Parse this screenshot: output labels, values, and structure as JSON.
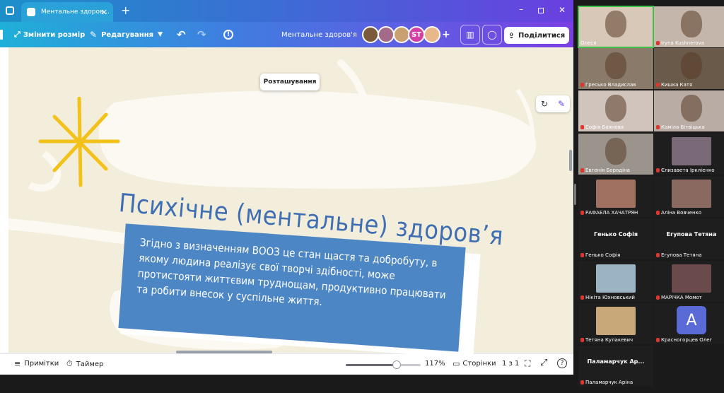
{
  "canva": {
    "tab_title": "Ментальне здоров...",
    "toolbar": {
      "resize": "Змінити розмір",
      "edit": "Редагування",
      "doc_title": "Ментальне здоров'я",
      "collab_initials": "ST",
      "share": "Поділитися"
    },
    "tooltip": "Розташування",
    "slide": {
      "title": "Психічне (ментальне) здоров’я",
      "body": "Згідно з визначенням ВООЗ це стан щастя та добробуту, в якому людина реалізує свої творчі здібності, може протистояти життєвим труднощам, продуктивно працювати та робити внесок у суспільне життя."
    },
    "status": {
      "notes": "Примітки",
      "timer": "Таймер",
      "zoom": "117%",
      "pages": "Сторінки",
      "page_count": "1 з 1",
      "zoom_fraction": 0.68
    }
  },
  "zoom": {
    "participants": [
      {
        "name": "Олеся",
        "active": true
      },
      {
        "name": "Iryna Kushnerova"
      },
      {
        "name": "Гресько Владислав"
      },
      {
        "name": "Кишка Катя"
      },
      {
        "name": "Софія Баянова"
      },
      {
        "name": "Каміла Бітвіцька"
      },
      {
        "name": "Евгенія Бородіна"
      },
      {
        "name": "Єлизавета Іркліенко"
      },
      {
        "name": "РАФАЕЛА ХАЧАТРЯН"
      },
      {
        "name": "Аліна Вовченко"
      },
      {
        "name": "Генько Софія",
        "big": "Генько Софія"
      },
      {
        "name": "Егупова Тетяна",
        "big": "Егупова Тетяна"
      },
      {
        "name": "Нікіта Юхновський"
      },
      {
        "name": "МАРІЧКА Момот"
      },
      {
        "name": "Тетяна Кулакевич"
      },
      {
        "name": "Красногорцев Олег",
        "avatar": "A"
      },
      {
        "name": "Паламарчук Аріна",
        "big": "Паламарчук  Ар..."
      }
    ]
  },
  "colors": {
    "accent": "#7b3fe4",
    "slide_blue": "#4d86c4",
    "star": "#f2c21b"
  }
}
